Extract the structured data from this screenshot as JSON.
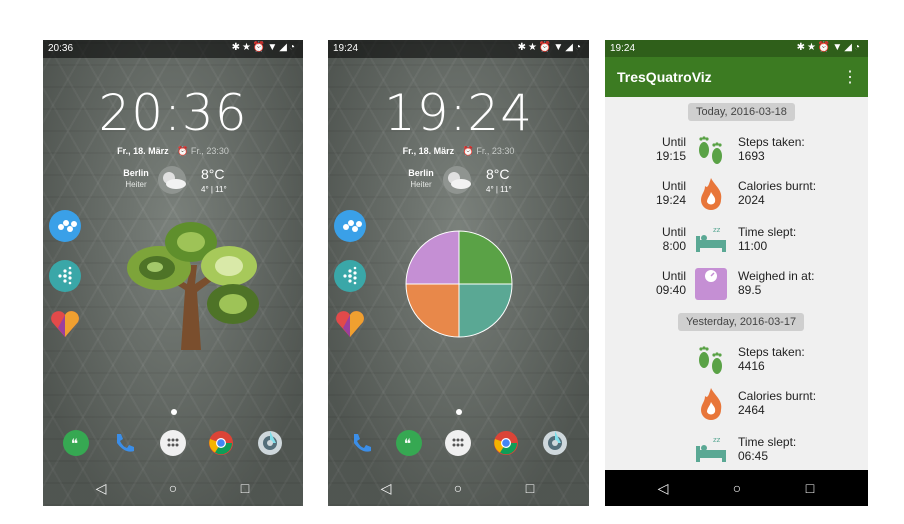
{
  "phone1": {
    "status_time": "20:36",
    "clock": "20:36",
    "date": "Fr., 18. März",
    "next_alarm": "Fr., 23:30",
    "city": "Berlin",
    "condition": "Heiter",
    "temperature": "8°C",
    "temp_range": "4° | 11°"
  },
  "phone2": {
    "status_time": "19:24",
    "clock": "19:24",
    "date": "Fr., 18. März",
    "next_alarm": "Fr., 23:30",
    "city": "Berlin",
    "condition": "Heiter",
    "temperature": "8°C",
    "temp_range": "4° | 11°",
    "pie_colors": [
      "#c58fd4",
      "#5aa246",
      "#e8884a",
      "#5aa894"
    ]
  },
  "app": {
    "status_time": "19:24",
    "title": "TresQuatroViz",
    "today_header": "Today, 2016-03-18",
    "yesterday_header": "Yesterday, 2016-03-17",
    "today": [
      {
        "until_1": "Until",
        "until_2": "19:15",
        "label": "Steps taken:",
        "value": "1693",
        "icon": "footprints-icon"
      },
      {
        "until_1": "Until",
        "until_2": "19:24",
        "label": "Calories burnt:",
        "value": "2024",
        "icon": "flame-icon"
      },
      {
        "until_1": "Until",
        "until_2": "8:00",
        "label": "Time slept:",
        "value": "11:00",
        "icon": "sleep-bed-icon"
      },
      {
        "until_1": "Until",
        "until_2": "09:40",
        "label": "Weighed in at:",
        "value": "89.5",
        "icon": "scale-icon"
      }
    ],
    "yesterday": [
      {
        "label": "Steps taken:",
        "value": "4416",
        "icon": "footprints-icon"
      },
      {
        "label": "Calories burnt:",
        "value": "2464",
        "icon": "flame-icon"
      },
      {
        "label": "Time slept:",
        "value": "06:45",
        "icon": "sleep-bed-icon"
      }
    ],
    "colors": {
      "appbar": "#3c7b22",
      "icon_green": "#5aa246",
      "flame": "#e8763a",
      "scale": "#c58fd4"
    }
  }
}
